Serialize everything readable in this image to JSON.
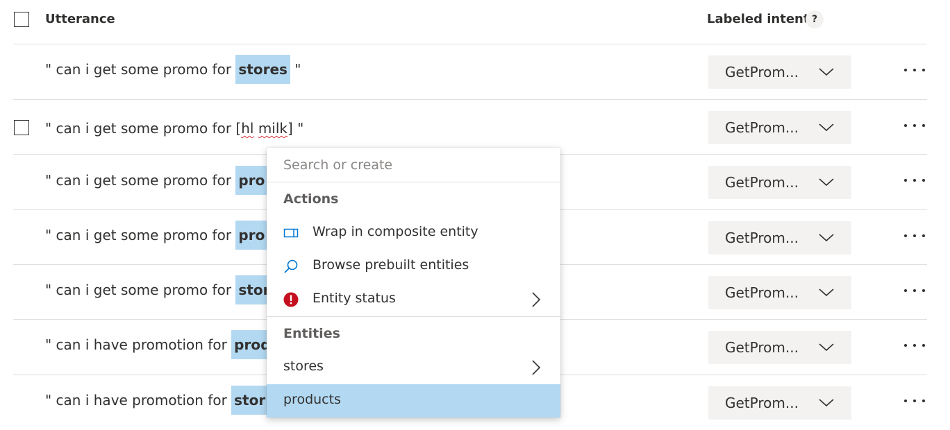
{
  "table": {
    "header": {
      "utterance": "Utterance",
      "labeled_intent": "Labeled intent",
      "help": "?"
    },
    "rows": [
      {
        "prefix": "\" can i get some promo for ",
        "entity": "stores",
        "suffix": " \"",
        "intent": "GetProm..."
      },
      {
        "prefix": "\" can i get some promo for [",
        "squiggle1": "hl",
        "mid": " ",
        "squiggle2": "milk",
        "suffix": "] \"",
        "intent": "GetProm..."
      },
      {
        "prefix": "\" can i get some promo for ",
        "entity": "pro",
        "intent": "GetProm..."
      },
      {
        "prefix": "\" can i get some promo for ",
        "entity": "pro",
        "intent": "GetProm..."
      },
      {
        "prefix": "\" can i get some promo for ",
        "entity": "stor",
        "intent": "GetProm..."
      },
      {
        "prefix": "\" can i have promotion for ",
        "entity": "prod",
        "intent": "GetProm..."
      },
      {
        "prefix": "\" can i have promotion for ",
        "entity": "stor",
        "intent": "GetProm..."
      }
    ]
  },
  "menu": {
    "search_placeholder": "Search or create",
    "actions_heading": "Actions",
    "actions": [
      {
        "label": "Wrap in composite entity",
        "icon": "composite-entity-icon"
      },
      {
        "label": "Browse prebuilt entities",
        "icon": "search-icon"
      },
      {
        "label": "Entity status",
        "icon": "error-status-icon"
      }
    ],
    "entities_heading": "Entities",
    "entities": [
      {
        "label": "stores"
      },
      {
        "label": "products",
        "selected": true
      }
    ]
  },
  "colors": {
    "entity_highlight": "#b3d9f2",
    "dropdown_bg": "#f3f2f1",
    "error_red": "#c50f1f",
    "icon_blue": "#0078d4"
  }
}
